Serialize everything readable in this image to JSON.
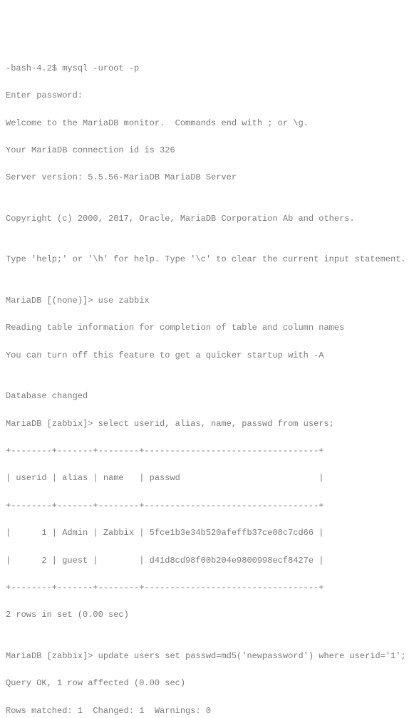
{
  "lines": {
    "l0": "-bash-4.2$ mysql -uroot -p",
    "l1": "Enter password:",
    "l2": "Welcome to the MariaDB monitor.  Commands end with ; or \\g.",
    "l3": "Your MariaDB connection id is 326",
    "l4": "Server version: 5.5.56-MariaDB MariaDB Server",
    "l5": "",
    "l6": "Copyright (c) 2000, 2017, Oracle, MariaDB Corporation Ab and others.",
    "l7": "",
    "l8": "Type 'help;' or '\\h' for help. Type '\\c' to clear the current input statement.",
    "l9": "",
    "l10": "MariaDB [(none)]> use zabbix",
    "l11": "Reading table information for completion of table and column names",
    "l12": "You can turn off this feature to get a quicker startup with -A",
    "l13": "",
    "l14": "Database changed",
    "l15": "MariaDB [zabbix]> select userid, alias, name, passwd from users;",
    "l16": "+--------+-------+--------+----------------------------------+",
    "l17": "| userid | alias | name   | passwd                           |",
    "l18": "+--------+-------+--------+----------------------------------+",
    "l19": "|      1 | Admin | Zabbix | 5fce1b3e34b520afeffb37ce08c7cd66 |",
    "l20": "|      2 | guest |        | d41d8cd98f00b204e9800998ecf8427e |",
    "l21": "+--------+-------+--------+----------------------------------+",
    "l22": "2 rows in set (0.00 sec)",
    "l23": "",
    "l24": "MariaDB [zabbix]> update users set passwd=md5('newpassword') where userid='1';",
    "l25": "Query OK, 1 row affected (0.00 sec)",
    "l26": "Rows matched: 1  Changed: 1  Warnings: 0"
  }
}
